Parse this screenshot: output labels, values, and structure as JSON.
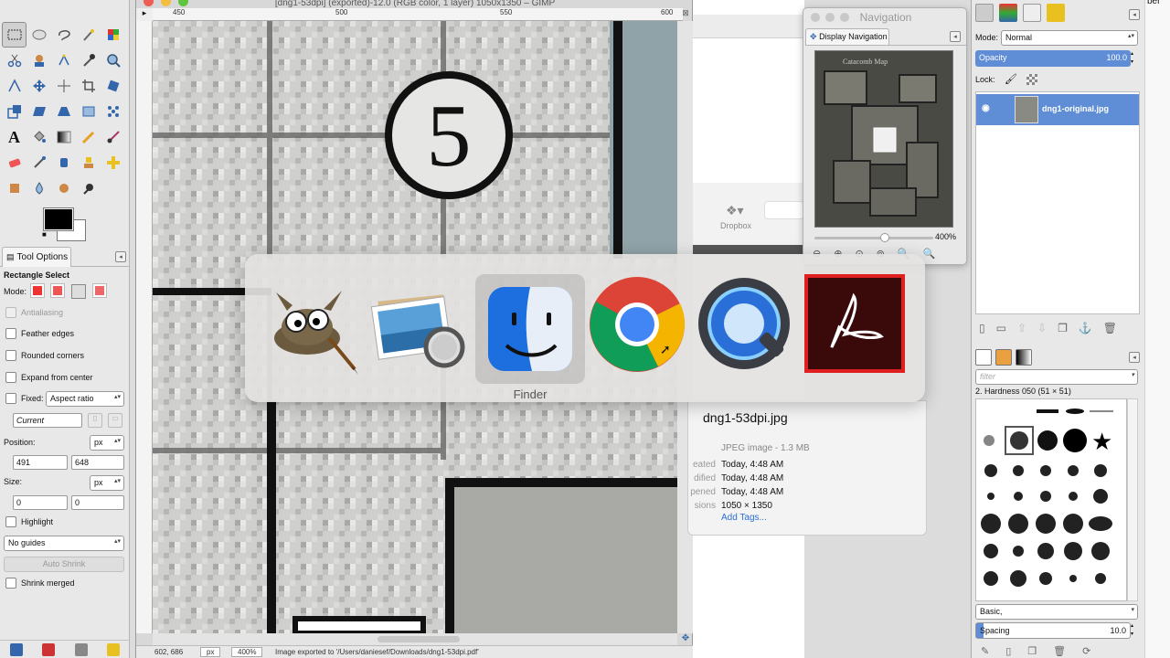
{
  "image_window": {
    "title": "[dng1-53dpi] (exported)-12.0 (RGB color, 1 layer) 1050x1350 – GIMP",
    "ruler_ticks": [
      "450",
      "500",
      "550",
      "600"
    ],
    "status_coords": "602, 686",
    "status_unit": "px",
    "status_zoom": "400%",
    "status_message": "Image exported to '/Users/daniesef/Downloads/dng1-53dpi.pdf'"
  },
  "toolbox": {
    "tab_label": "Tool Options",
    "tool_name": "Rectangle Select",
    "mode_label": "Mode:",
    "antialiasing": "Antialiasing",
    "feather_edges": "Feather edges",
    "rounded_corners": "Rounded corners",
    "expand_from_center": "Expand from center",
    "fixed_label": "Fixed:",
    "fixed_value": "Aspect ratio",
    "current_placeholder": "Current",
    "position_label": "Position:",
    "position_unit": "px",
    "position_x": "491",
    "position_y": "648",
    "size_label": "Size:",
    "size_unit": "px",
    "size_w": "0",
    "size_h": "0",
    "highlight": "Highlight",
    "guides_value": "No guides",
    "auto_shrink": "Auto Shrink",
    "shrink_merged": "Shrink merged"
  },
  "navigation": {
    "window_title": "Navigation",
    "tab_label": "Display Navigation",
    "zoom": "400%"
  },
  "background_finder": {
    "dropbox_label": "Dropbox",
    "file_name": "dng1-53dpi.jpg",
    "file_kind": "JPEG image - 1.3 MB",
    "rows": [
      {
        "label": "eated",
        "value": "Today, 4:48 AM"
      },
      {
        "label": "dified",
        "value": "Today, 4:48 AM"
      },
      {
        "label": "pened",
        "value": "Today, 4:48 AM"
      },
      {
        "label": "sions",
        "value": "1050 × 1350"
      }
    ],
    "add_tags": "Add Tags..."
  },
  "layers": {
    "mode_label": "Mode:",
    "mode_value": "Normal",
    "opacity_label": "Opacity",
    "opacity_value": "100.0",
    "lock_label": "Lock:",
    "layer_name": "dng1-original.jpg"
  },
  "brushes": {
    "filter_placeholder": "filter",
    "brush_name": "2. Hardness 050 (51 × 51)",
    "preset": "Basic,",
    "spacing_label": "Spacing",
    "spacing_value": "10.0"
  },
  "app_switcher": {
    "apps": [
      {
        "name": "GIMP",
        "icon": "gimp-icon"
      },
      {
        "name": "Preview",
        "icon": "preview-icon"
      },
      {
        "name": "Finder",
        "icon": "finder-icon"
      },
      {
        "name": "Google Chrome",
        "icon": "chrome-icon"
      },
      {
        "name": "QuickTime Player",
        "icon": "quicktime-icon"
      },
      {
        "name": "Adobe Acrobat Reader",
        "icon": "acrobat-icon"
      }
    ],
    "selected_label": "Finder"
  },
  "corner_text": "ber"
}
